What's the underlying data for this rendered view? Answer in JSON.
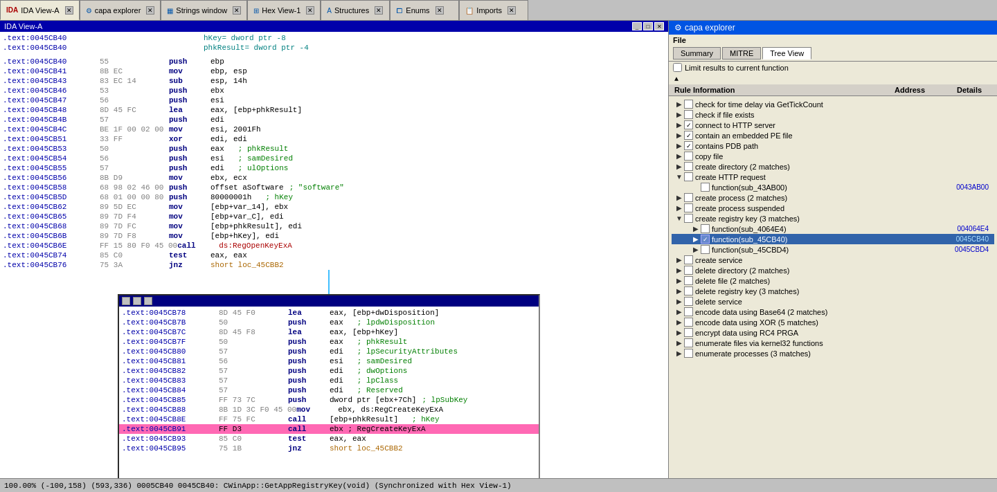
{
  "tabs": [
    {
      "label": "IDA View-A",
      "active": true,
      "icon": "ida"
    },
    {
      "label": "capa explorer",
      "active": false,
      "icon": "capa"
    },
    {
      "label": "Strings window",
      "active": false,
      "icon": "strings"
    },
    {
      "label": "Hex View-1",
      "active": false,
      "icon": "hex"
    },
    {
      "label": "Structures",
      "active": false,
      "icon": "struct"
    },
    {
      "label": "Enums",
      "active": false,
      "icon": "enum"
    },
    {
      "label": "Imports",
      "active": false,
      "icon": "imports"
    }
  ],
  "ida_title": "IDA View-A",
  "disasm_upper": [
    {
      "addr": ".text:0045CB40",
      "bytes": "",
      "mnem": "",
      "op": "hKey= dword ptr -8",
      "comment": "",
      "type": "header"
    },
    {
      "addr": ".text:0045CB40",
      "bytes": "",
      "mnem": "",
      "op": "phkResult= dword ptr -4",
      "comment": "",
      "type": "header"
    },
    {
      "addr": ".text:0045CB40",
      "bytes": "",
      "mnem": "",
      "op": "",
      "comment": "",
      "type": "empty"
    },
    {
      "addr": ".text:0045CB40",
      "bytes": "55",
      "mnem": "push",
      "op": "ebp",
      "comment": "",
      "type": "normal"
    },
    {
      "addr": ".text:0045CB41",
      "bytes": "8B EC",
      "mnem": "mov",
      "op": "ebp, esp",
      "comment": "",
      "type": "normal"
    },
    {
      "addr": ".text:0045CB43",
      "bytes": "83 EC 14",
      "mnem": "sub",
      "op": "esp, 14h",
      "comment": "",
      "type": "normal"
    },
    {
      "addr": ".text:0045CB46",
      "bytes": "53",
      "mnem": "push",
      "op": "ebx",
      "comment": "",
      "type": "normal"
    },
    {
      "addr": ".text:0045CB47",
      "bytes": "56",
      "mnem": "push",
      "op": "esi",
      "comment": "",
      "type": "normal"
    },
    {
      "addr": ".text:0045CB48",
      "bytes": "8D 45 FC",
      "mnem": "lea",
      "op": "eax, [ebp+phkResult]",
      "comment": "",
      "type": "normal"
    },
    {
      "addr": ".text:0045CB4B",
      "bytes": "57",
      "mnem": "push",
      "op": "edi",
      "comment": "",
      "type": "normal"
    },
    {
      "addr": ".text:0045CB4C",
      "bytes": "BE 1F 00 02 00",
      "mnem": "mov",
      "op": "esi, 2001Fh",
      "comment": "",
      "type": "normal"
    },
    {
      "addr": ".text:0045CB51",
      "bytes": "33 FF",
      "mnem": "xor",
      "op": "edi, edi",
      "comment": "",
      "type": "normal"
    },
    {
      "addr": ".text:0045CB53",
      "bytes": "50",
      "mnem": "push",
      "op": "eax",
      "comment": "; phkResult",
      "type": "normal"
    },
    {
      "addr": ".text:0045CB54",
      "bytes": "56",
      "mnem": "push",
      "op": "esi",
      "comment": "; samDesired",
      "type": "normal"
    },
    {
      "addr": ".text:0045CB55",
      "bytes": "57",
      "mnem": "push",
      "op": "edi",
      "comment": "; ulOptions",
      "type": "normal"
    },
    {
      "addr": ".text:0045CB56",
      "bytes": "8B D9",
      "mnem": "mov",
      "op": "ebx, ecx",
      "comment": "",
      "type": "normal"
    },
    {
      "addr": ".text:0045CB58",
      "bytes": "68 98 02 46 00",
      "mnem": "push",
      "op": "offset aSoftware",
      "comment": "; \"software\"",
      "type": "normal"
    },
    {
      "addr": ".text:0045CB5D",
      "bytes": "68 01 00 00 80",
      "mnem": "push",
      "op": "80000001h",
      "comment": "; hKey",
      "type": "normal"
    },
    {
      "addr": ".text:0045CB62",
      "bytes": "89 5D EC",
      "mnem": "mov",
      "op": "[ebp+var_14], ebx",
      "comment": "",
      "type": "normal"
    },
    {
      "addr": ".text:0045CB65",
      "bytes": "89 7D F4",
      "mnem": "mov",
      "op": "[ebp+var_C], edi",
      "comment": "",
      "type": "normal"
    },
    {
      "addr": ".text:0045CB68",
      "bytes": "89 7D FC",
      "mnem": "mov",
      "op": "[ebp+phkResult], edi",
      "comment": "",
      "type": "normal"
    },
    {
      "addr": ".text:0045CB6B",
      "bytes": "89 7D F8",
      "mnem": "mov",
      "op": "[ebp+hKey], edi",
      "comment": "",
      "type": "normal"
    },
    {
      "addr": ".text:0045CB6E",
      "bytes": "FF 15 80 F0 45 00",
      "mnem": "call",
      "op": "ds:RegOpenKeyExA",
      "comment": "",
      "type": "normal"
    },
    {
      "addr": ".text:0045CB74",
      "bytes": "85 C0",
      "mnem": "test",
      "op": "eax, eax",
      "comment": "",
      "type": "normal"
    },
    {
      "addr": ".text:0045CB76",
      "bytes": "75 3A",
      "mnem": "jnz",
      "op": "short loc_45CBB2",
      "comment": "",
      "type": "normal"
    }
  ],
  "disasm_lower": [
    {
      "addr": ".text:0045CB78",
      "bytes": "8D 45 F0",
      "mnem": "lea",
      "op": "eax, [ebp+dwDisposition]",
      "comment": "",
      "type": "normal"
    },
    {
      "addr": ".text:0045CB7B",
      "bytes": "50",
      "mnem": "push",
      "op": "eax",
      "comment": "; lpdwDisposition",
      "type": "normal"
    },
    {
      "addr": ".text:0045CB7C",
      "bytes": "8D 45 F8",
      "mnem": "lea",
      "op": "eax, [ebp+hKey]",
      "comment": "",
      "type": "normal"
    },
    {
      "addr": ".text:0045CB7F",
      "bytes": "50",
      "mnem": "push",
      "op": "eax",
      "comment": "; phkResult",
      "type": "normal"
    },
    {
      "addr": ".text:0045CB80",
      "bytes": "57",
      "mnem": "push",
      "op": "edi",
      "comment": "; lpSecurityAttributes",
      "type": "normal"
    },
    {
      "addr": ".text:0045CB81",
      "bytes": "56",
      "mnem": "push",
      "op": "esi",
      "comment": "; samDesired",
      "type": "normal"
    },
    {
      "addr": ".text:0045CB82",
      "bytes": "57",
      "mnem": "push",
      "op": "edi",
      "comment": "; dwOptions",
      "type": "normal"
    },
    {
      "addr": ".text:0045CB83",
      "bytes": "57",
      "mnem": "push",
      "op": "edi",
      "comment": "; lpClass",
      "type": "normal"
    },
    {
      "addr": ".text:0045CB84",
      "bytes": "57",
      "mnem": "push",
      "op": "edi",
      "comment": "; Reserved",
      "type": "normal"
    },
    {
      "addr": ".text:0045CB85",
      "bytes": "FF 73 7C",
      "mnem": "push",
      "op": "dword ptr [ebx+7Ch]",
      "comment": "; lpSubKey",
      "type": "normal"
    },
    {
      "addr": ".text:0045CB88",
      "bytes": "8B 1D 3C F0 45 00",
      "mnem": "mov",
      "op": "ebx, ds:RegCreateKeyExA",
      "comment": "",
      "type": "normal"
    },
    {
      "addr": ".text:0045CB8E",
      "bytes": "FF 75 FC",
      "mnem": "call",
      "op": "[ebp+phkResult]",
      "comment": "; hKey",
      "type": "normal"
    },
    {
      "addr": ".text:0045CB91",
      "bytes": "FF D3",
      "mnem": "call",
      "op": "ebx ; RegCreateKeyExA",
      "comment": "",
      "type": "highlighted"
    },
    {
      "addr": ".text:0045CB93",
      "bytes": "85 C0",
      "mnem": "test",
      "op": "eax, eax",
      "comment": "",
      "type": "normal"
    },
    {
      "addr": ".text:0045CB95",
      "bytes": "75 1B",
      "mnem": "jnz",
      "op": "short loc_45CBB2",
      "comment": "",
      "type": "normal"
    }
  ],
  "capa": {
    "title": "capa explorer",
    "file_label": "File",
    "tabs": [
      "Summary",
      "MITRE",
      "Tree View"
    ],
    "active_tab": "Tree View",
    "limit_checkbox": "Limit results to current function",
    "limit_checked": false,
    "columns": [
      "Rule Information",
      "Address",
      "Details"
    ],
    "rules": [
      {
        "indent": 0,
        "expand": true,
        "checked": false,
        "label": "check for time delay via GetTickCount",
        "addr": "",
        "has_children": false,
        "expanded": false
      },
      {
        "indent": 0,
        "expand": true,
        "checked": false,
        "label": "check if file exists",
        "addr": "",
        "has_children": false,
        "expanded": false
      },
      {
        "indent": 0,
        "expand": true,
        "checked": true,
        "label": "connect to HTTP server",
        "addr": "",
        "has_children": false,
        "expanded": false
      },
      {
        "indent": 0,
        "expand": true,
        "checked": true,
        "label": "contain an embedded PE file",
        "addr": "",
        "has_children": false,
        "expanded": false
      },
      {
        "indent": 0,
        "expand": true,
        "checked": true,
        "label": "contains PDB path",
        "addr": "",
        "has_children": false,
        "expanded": false
      },
      {
        "indent": 0,
        "expand": true,
        "checked": false,
        "label": "copy file",
        "addr": "",
        "has_children": false,
        "expanded": false
      },
      {
        "indent": 0,
        "expand": true,
        "checked": false,
        "label": "create directory (2 matches)",
        "addr": "",
        "has_children": false,
        "expanded": false
      },
      {
        "indent": 0,
        "expand": true,
        "checked": false,
        "label": "create HTTP request",
        "addr": "",
        "has_children": true,
        "expanded": true
      },
      {
        "indent": 1,
        "expand": false,
        "checked": false,
        "label": "function(sub_43AB00)",
        "addr": "0043AB00",
        "has_children": false,
        "expanded": false
      },
      {
        "indent": 0,
        "expand": true,
        "checked": false,
        "label": "create process (2 matches)",
        "addr": "",
        "has_children": false,
        "expanded": false
      },
      {
        "indent": 0,
        "expand": true,
        "checked": false,
        "label": "create process suspended",
        "addr": "",
        "has_children": false,
        "expanded": false
      },
      {
        "indent": 0,
        "expand": true,
        "checked": false,
        "label": "create registry key (3 matches)",
        "addr": "",
        "has_children": true,
        "expanded": true
      },
      {
        "indent": 1,
        "expand": false,
        "checked": false,
        "label": "function(sub_4064E4)",
        "addr": "004064E4",
        "has_children": false,
        "expanded": false
      },
      {
        "indent": 1,
        "expand": false,
        "checked": true,
        "label": "function(sub_45CB40)",
        "addr": "0045CB40",
        "has_children": false,
        "expanded": false,
        "selected": true
      },
      {
        "indent": 1,
        "expand": false,
        "checked": false,
        "label": "function(sub_45CBD4)",
        "addr": "0045CBD4",
        "has_children": false,
        "expanded": false
      },
      {
        "indent": 0,
        "expand": true,
        "checked": false,
        "label": "create service",
        "addr": "",
        "has_children": false,
        "expanded": false
      },
      {
        "indent": 0,
        "expand": true,
        "checked": false,
        "label": "delete directory (2 matches)",
        "addr": "",
        "has_children": false,
        "expanded": false
      },
      {
        "indent": 0,
        "expand": true,
        "checked": false,
        "label": "delete file (2 matches)",
        "addr": "",
        "has_children": false,
        "expanded": false
      },
      {
        "indent": 0,
        "expand": true,
        "checked": false,
        "label": "delete registry key (3 matches)",
        "addr": "",
        "has_children": false,
        "expanded": false
      },
      {
        "indent": 0,
        "expand": true,
        "checked": false,
        "label": "delete service",
        "addr": "",
        "has_children": false,
        "expanded": false
      },
      {
        "indent": 0,
        "expand": true,
        "checked": false,
        "label": "encode data using Base64 (2 matches)",
        "addr": "",
        "has_children": false,
        "expanded": false
      },
      {
        "indent": 0,
        "expand": true,
        "checked": false,
        "label": "encode data using XOR (5 matches)",
        "addr": "",
        "has_children": false,
        "expanded": false
      },
      {
        "indent": 0,
        "expand": true,
        "checked": false,
        "label": "encrypt data using RC4 PRGA",
        "addr": "",
        "has_children": false,
        "expanded": false
      },
      {
        "indent": 0,
        "expand": true,
        "checked": false,
        "label": "enumerate files via kernel32 functions",
        "addr": "",
        "has_children": false,
        "expanded": false
      },
      {
        "indent": 0,
        "expand": true,
        "checked": false,
        "label": "enumerate processes (3 matches)",
        "addr": "",
        "has_children": false,
        "expanded": false
      }
    ]
  },
  "status_bar": "100.00% (-100,158) (593,336) 0005CB40 0045CB40: CWinApp::GetAppRegistryKey(void) (Synchronized with Hex View-1)"
}
